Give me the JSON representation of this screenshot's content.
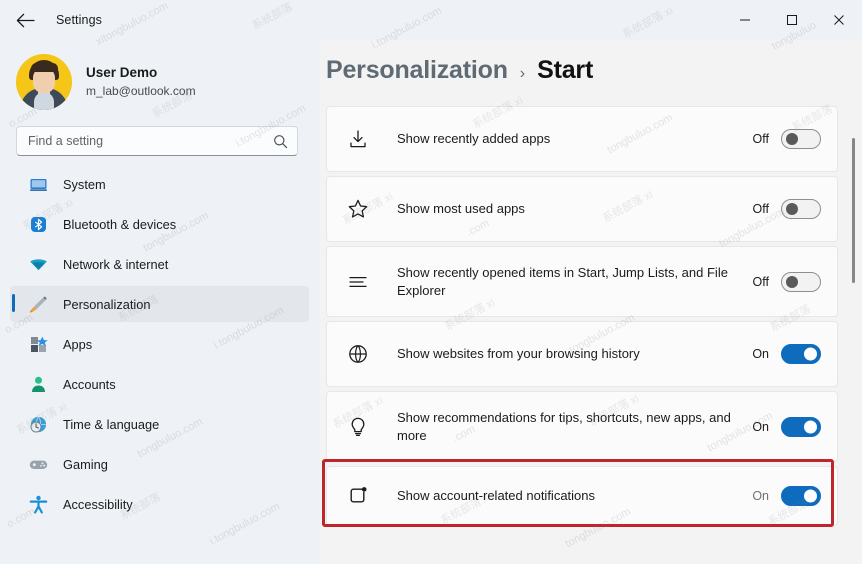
{
  "window": {
    "title": "Settings",
    "back_icon": "arrow-left-icon",
    "controls": {
      "minimize": "minimize-icon",
      "maximize": "maximize-icon",
      "close": "close-icon"
    }
  },
  "account": {
    "name": "User Demo",
    "email": "m_lab@outlook.com",
    "avatar": "user-avatar"
  },
  "search": {
    "placeholder": "Find a setting",
    "value": "",
    "icon": "search-icon"
  },
  "sidebar": {
    "items": [
      {
        "label": "System",
        "icon": "monitor-icon",
        "active": false
      },
      {
        "label": "Bluetooth & devices",
        "icon": "bluetooth-icon",
        "active": false
      },
      {
        "label": "Network & internet",
        "icon": "wifi-icon",
        "active": false
      },
      {
        "label": "Personalization",
        "icon": "paintbrush-icon",
        "active": true
      },
      {
        "label": "Apps",
        "icon": "apps-icon",
        "active": false
      },
      {
        "label": "Accounts",
        "icon": "person-icon",
        "active": false
      },
      {
        "label": "Time & language",
        "icon": "clock-globe-icon",
        "active": false
      },
      {
        "label": "Gaming",
        "icon": "gamepad-icon",
        "active": false
      },
      {
        "label": "Accessibility",
        "icon": "accessibility-icon",
        "active": false
      }
    ]
  },
  "breadcrumb": {
    "parent": "Personalization",
    "separator": "›",
    "current": "Start"
  },
  "settings_rows": [
    {
      "label": "Show recently added apps",
      "icon": "download-icon",
      "state": "Off",
      "on": false,
      "highlighted": false
    },
    {
      "label": "Show most used apps",
      "icon": "star-icon",
      "state": "Off",
      "on": false,
      "highlighted": false
    },
    {
      "label": "Show recently opened items in Start, Jump Lists, and File Explorer",
      "icon": "list-lines-icon",
      "state": "Off",
      "on": false,
      "highlighted": false
    },
    {
      "label": "Show websites from your browsing history",
      "icon": "globe-icon",
      "state": "On",
      "on": true,
      "highlighted": false
    },
    {
      "label": "Show recommendations for tips, shortcuts, new apps, and more",
      "icon": "lightbulb-icon",
      "state": "On",
      "on": true,
      "highlighted": false
    },
    {
      "label": "Show account-related notifications",
      "icon": "notification-badge-icon",
      "state": "On",
      "on": true,
      "highlighted": true
    }
  ],
  "annotation": {
    "color": "#c0252b",
    "target": "Show account-related notifications"
  },
  "colors": {
    "accent": "#0f6cbd",
    "sidebar_bg": "#eef2f6",
    "main_bg": "#f3f3f3",
    "card_bg": "#fbfbfb",
    "highlight": "#c0252b"
  },
  "watermark": {
    "latin": "xitongbuluo.com",
    "latin_alt": "i.tongbuluo.com",
    "cn": "系统部落"
  }
}
